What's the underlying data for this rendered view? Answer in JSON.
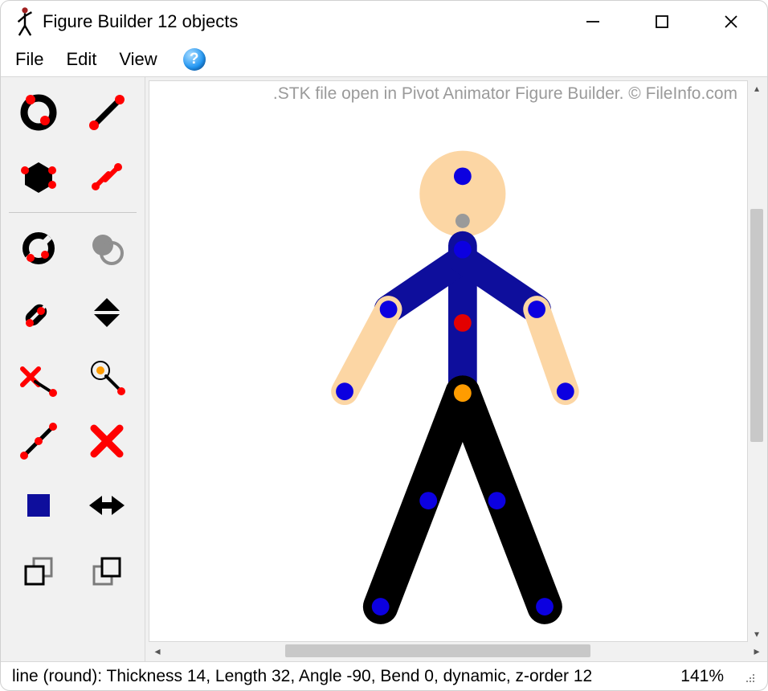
{
  "window": {
    "title": "Figure Builder   12 objects"
  },
  "menu": {
    "file": "File",
    "edit": "Edit",
    "view": "View"
  },
  "canvas": {
    "watermark": ".STK file open in Pivot Animator Figure Builder. © FileInfo.com"
  },
  "status": {
    "info": "line (round): Thickness 14, Length 32, Angle -90, Bend 0, dynamic, z-order 12",
    "zoom": "141%"
  },
  "tools": {
    "add_circle": "add-circle",
    "add_line": "add-line",
    "add_polygon": "add-polygon",
    "add_spring": "add-spring",
    "toggle_circle": "toggle-circle-outline",
    "opacity": "opacity",
    "toggle_line_circle": "toggle-line-circle",
    "flip_vertical": "flip-vertical",
    "delete_point": "delete-point",
    "origin": "set-origin",
    "split": "split-segment",
    "delete": "delete",
    "fill_color": "fill-color",
    "flip_horizontal": "flip-horizontal",
    "send_back": "send-back",
    "bring_front": "bring-front"
  },
  "figure": {
    "skin": "#fcd6a4",
    "shirt": "#0e0e9c",
    "pants": "#000000",
    "joint_blue": "#0c00e0",
    "joint_red": "#e30000",
    "joint_orange": "#ff9c00",
    "joint_gray": "#9a9a9a"
  }
}
